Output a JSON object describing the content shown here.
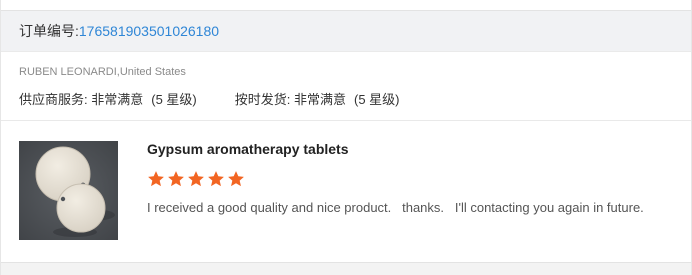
{
  "order": {
    "label": "订单编号:",
    "number": "176581903501026180"
  },
  "buyer": {
    "name": "RUBEN LEONARDI",
    "separator": ",",
    "country": "United States"
  },
  "ratings": [
    {
      "label": "供应商服务: 非常满意",
      "level": "(5 星级)"
    },
    {
      "label": "按时发货: 非常满意",
      "level": "(5 星级)"
    }
  ],
  "product": {
    "title": "Gypsum aromatherapy tablets",
    "stars": 5,
    "review": "I received a good quality and nice product.   thanks.   I'll contacting you again in future."
  },
  "colors": {
    "accent_link": "#2f86d6",
    "star": "#f26522"
  }
}
